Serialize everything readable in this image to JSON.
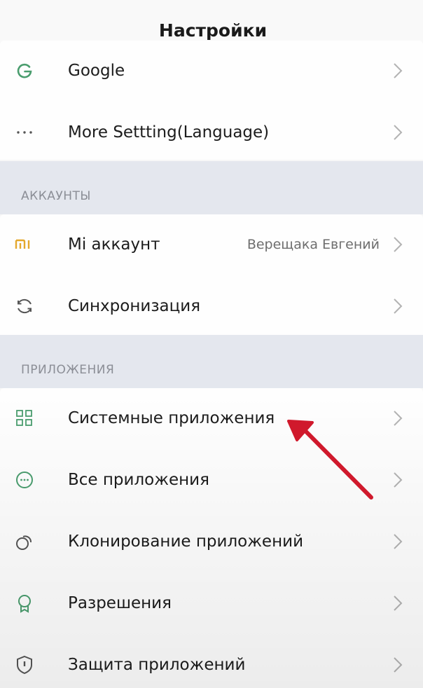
{
  "header": {
    "title": "Настройки"
  },
  "group1": {
    "items": [
      {
        "icon": "google-icon",
        "label": "Google"
      },
      {
        "icon": "more-dots-icon",
        "label": "More Settting(Language)"
      }
    ]
  },
  "accounts": {
    "header": "АККАУНТЫ",
    "items": [
      {
        "icon": "mi-logo-icon",
        "label": "Mi аккаунт",
        "value": "Верещака Евгений"
      },
      {
        "icon": "sync-icon",
        "label": "Синхронизация"
      }
    ]
  },
  "apps": {
    "header": "ПРИЛОЖЕНИЯ",
    "items": [
      {
        "icon": "grid-apps-icon",
        "label": "Системные приложения"
      },
      {
        "icon": "all-apps-icon",
        "label": "Все приложения"
      },
      {
        "icon": "clone-apps-icon",
        "label": "Клонирование приложений"
      },
      {
        "icon": "permissions-icon",
        "label": "Разрешения"
      },
      {
        "icon": "app-lock-shield-icon",
        "label": "Защита приложений"
      }
    ]
  },
  "colors": {
    "accent_arrow": "#d0192c",
    "section_bg": "#e4e7ee",
    "mi_orange": "#e4a82c",
    "google_green": "#4a9d6e"
  },
  "annotation": {
    "icon": "red-arrow-pointer"
  }
}
